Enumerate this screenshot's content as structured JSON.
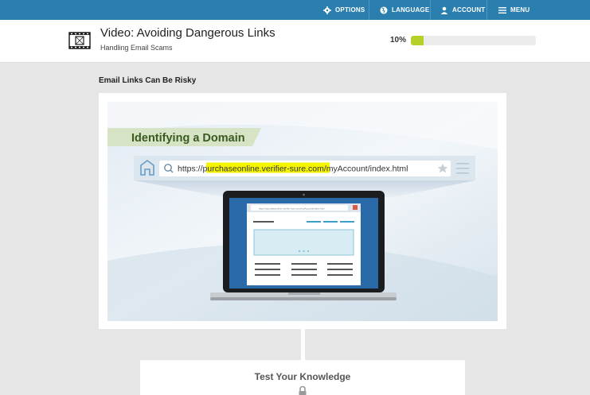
{
  "nav": {
    "options": "OPTIONS",
    "language": "LANGUAGE",
    "account": "ACCOUNT",
    "menu": "MENU"
  },
  "header": {
    "title": "Video: Avoiding Dangerous Links",
    "subtitle": "Handling Email Scams",
    "progress_label": "10%",
    "progress_value": 0.1
  },
  "section": {
    "title": "Email Links Can Be Risky"
  },
  "video": {
    "banner": "Identifying a Domain",
    "url_prefix": "https://",
    "url_domain": "purchaseonline.verifier-sure.com",
    "url_path": "/myAccount/index.html",
    "mini_url": "https://purchaseonline.verifier-sure.com/myAccount/index.html"
  },
  "knowledge": {
    "title": "Test Your Knowledge"
  },
  "colors": {
    "nav_bg": "#2a7fae",
    "progress_fill": "#b7cf27",
    "highlight": "#f4f400",
    "banner_text": "#3a5a22"
  }
}
